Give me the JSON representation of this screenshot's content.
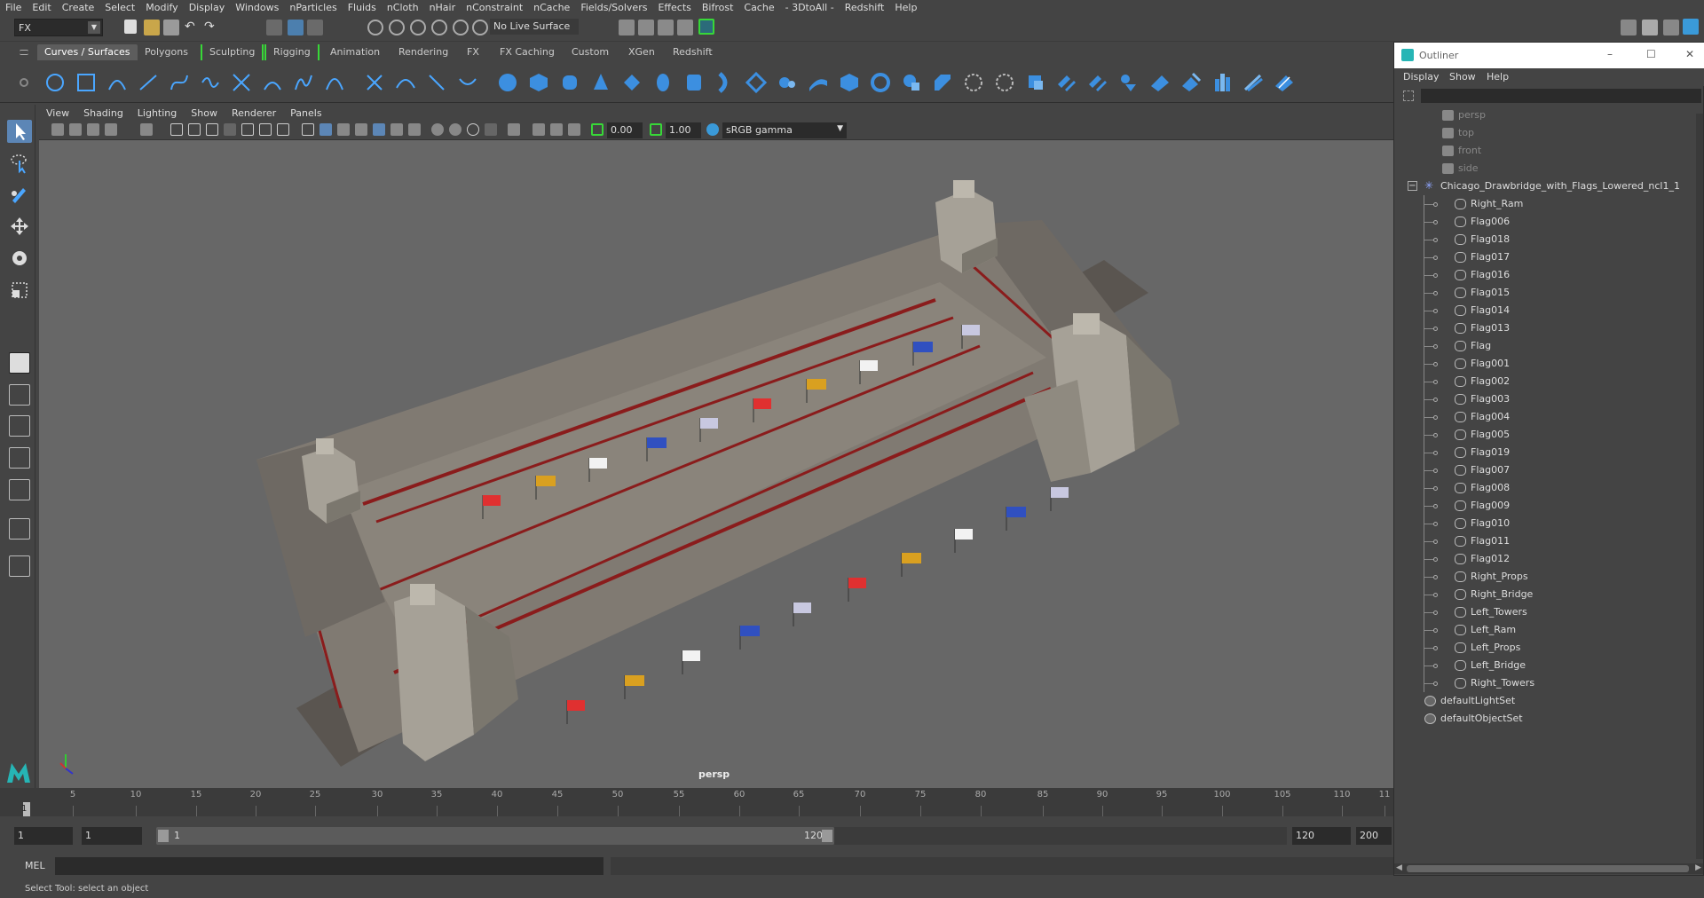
{
  "menubar": [
    "File",
    "Edit",
    "Create",
    "Select",
    "Modify",
    "Display",
    "Windows",
    "nParticles",
    "Fluids",
    "nCloth",
    "nHair",
    "nConstraint",
    "nCache",
    "Fields/Solvers",
    "Effects",
    "Bifrost",
    "Cache",
    "- 3DtoAll -",
    "Redshift",
    "Help"
  ],
  "statusline": {
    "mode": "FX",
    "live_surface": "No Live Surface"
  },
  "shelf_tabs": [
    "Curves / Surfaces",
    "Polygons",
    "Sculpting",
    "Rigging",
    "Animation",
    "Rendering",
    "FX",
    "FX Caching",
    "Custom",
    "XGen",
    "Redshift"
  ],
  "viewport": {
    "menu": [
      "View",
      "Shading",
      "Lighting",
      "Show",
      "Renderer",
      "Panels"
    ],
    "exposure": "0.00",
    "gamma": "1.00",
    "colorspace": "sRGB gamma",
    "camera_label": "persp"
  },
  "timeline": {
    "ticks": [
      "1",
      "5",
      "10",
      "15",
      "20",
      "25",
      "30",
      "35",
      "40",
      "45",
      "50",
      "55",
      "60",
      "65",
      "70",
      "75",
      "80",
      "85",
      "90",
      "95",
      "100",
      "105",
      "110",
      "11"
    ],
    "current": "1"
  },
  "range": {
    "start_field": "1",
    "current_field": "1",
    "slider_start": "1",
    "slider_end": "120",
    "end_field": "120",
    "max_field": "200"
  },
  "cmdline": {
    "label": "MEL"
  },
  "help_text": "Select Tool: select an object",
  "outliner": {
    "title": "Outliner",
    "menu": [
      "Display",
      "Show",
      "Help"
    ],
    "cameras": [
      "persp",
      "top",
      "front",
      "side"
    ],
    "root": "Chicago_Drawbridge_with_Flags_Lowered_ncl1_1",
    "children": [
      "Right_Ram",
      "Flag006",
      "Flag018",
      "Flag017",
      "Flag016",
      "Flag015",
      "Flag014",
      "Flag013",
      "Flag",
      "Flag001",
      "Flag002",
      "Flag003",
      "Flag004",
      "Flag005",
      "Flag019",
      "Flag007",
      "Flag008",
      "Flag009",
      "Flag010",
      "Flag011",
      "Flag012",
      "Right_Props",
      "Right_Bridge",
      "Left_Towers",
      "Left_Ram",
      "Left_Props",
      "Left_Bridge",
      "Right_Towers"
    ],
    "sets": [
      "defaultLightSet",
      "defaultObjectSet"
    ]
  },
  "colors": {
    "accent": "#3a9ad9",
    "active_tab_bracket": "#38d838",
    "bridge_red": "#8a1c1c"
  }
}
